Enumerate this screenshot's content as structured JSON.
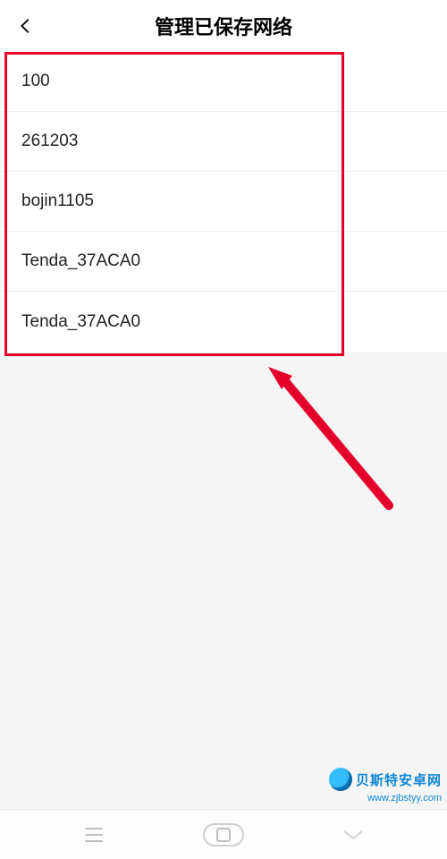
{
  "header": {
    "title": "管理已保存网络"
  },
  "networks": [
    {
      "name": "100"
    },
    {
      "name": "261203"
    },
    {
      "name": "bojin1105"
    },
    {
      "name": "Tenda_37ACA0"
    },
    {
      "name": "Tenda_37ACA0"
    }
  ],
  "watermark": {
    "title": "贝斯特安卓网",
    "url": "www.zjbstyy.com"
  }
}
